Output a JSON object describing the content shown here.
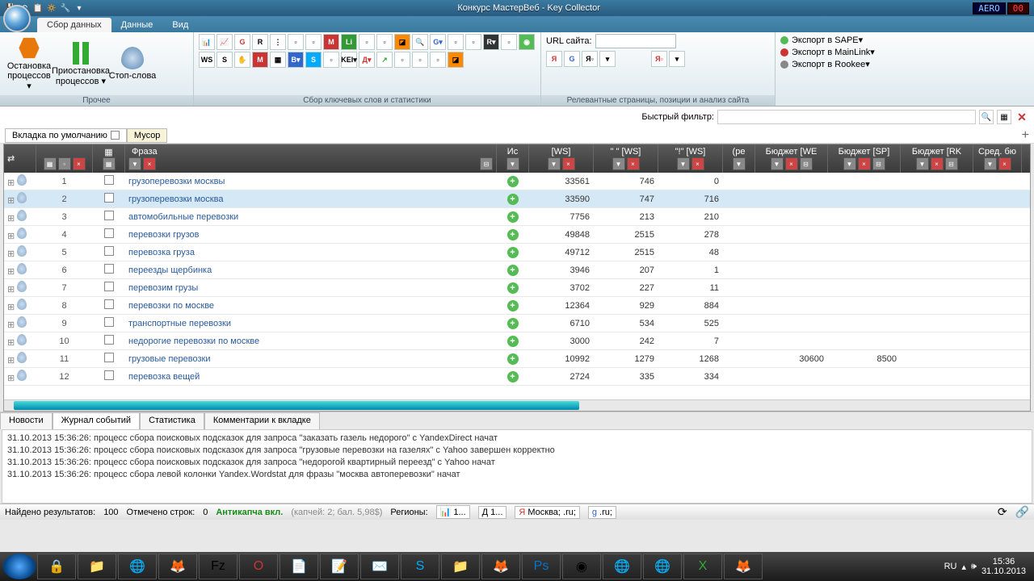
{
  "titlebar": {
    "title": "Конкурс МастерВеб - Key Collector",
    "aero_label": "AERO",
    "lcd": "00"
  },
  "tabs": {
    "t1": "Сбор данных",
    "t2": "Данные",
    "t3": "Вид"
  },
  "ribbon": {
    "stop": "Остановка процессов ▾",
    "pause": "Приостановка процессов ▾",
    "stopwords": "Стоп-слова",
    "group1": "Прочее",
    "group2": "Сбор ключевых слов и статистики",
    "url_label": "URL сайта:",
    "group3": "Релевантные страницы, позиции и анализ сайта",
    "exp_sape": "Экспорт в SAPE▾",
    "exp_main": "Экспорт в MainLink▾",
    "exp_rookee": "Экспорт в Rookee▾"
  },
  "filter": {
    "label": "Быстрый фильтр:"
  },
  "worktabs": {
    "t1": "Вкладка по умолчанию",
    "t2": "Мусор"
  },
  "cols": {
    "phrase": "Фраза",
    "src": "Ис",
    "ws": "[WS]",
    "qws": "\" \" [WS]",
    "ews": "\"!\" [WS]",
    "rel": "(ре",
    "we": "Бюджет [WE",
    "sp": "Бюджет [SP]",
    "rk": "Бюджет [RK",
    "avg": "Сред. бю"
  },
  "rows": [
    {
      "n": "1",
      "phrase": "грузоперевозки москвы",
      "ws": "33561",
      "qws": "746",
      "ews": "0"
    },
    {
      "n": "2",
      "phrase": "грузоперевозки москва",
      "ws": "33590",
      "qws": "747",
      "ews": "716",
      "sel": true
    },
    {
      "n": "3",
      "phrase": "автомобильные перевозки",
      "ws": "7756",
      "qws": "213",
      "ews": "210"
    },
    {
      "n": "4",
      "phrase": "перевозки грузов",
      "ws": "49848",
      "qws": "2515",
      "ews": "278"
    },
    {
      "n": "5",
      "phrase": "перевозка груза",
      "ws": "49712",
      "qws": "2515",
      "ews": "48"
    },
    {
      "n": "6",
      "phrase": "переезды щербинка",
      "ws": "3946",
      "qws": "207",
      "ews": "1"
    },
    {
      "n": "7",
      "phrase": "перевозим грузы",
      "ws": "3702",
      "qws": "227",
      "ews": "11"
    },
    {
      "n": "8",
      "phrase": "перевозки по москве",
      "ws": "12364",
      "qws": "929",
      "ews": "884"
    },
    {
      "n": "9",
      "phrase": "транспортные перевозки",
      "ws": "6710",
      "qws": "534",
      "ews": "525"
    },
    {
      "n": "10",
      "phrase": "недорогие перевозки по москве",
      "ws": "3000",
      "qws": "242",
      "ews": "7"
    },
    {
      "n": "11",
      "phrase": "грузовые перевозки",
      "ws": "10992",
      "qws": "1279",
      "ews": "1268",
      "we": "30600",
      "sp": "8500"
    },
    {
      "n": "12",
      "phrase": "перевозка вещей",
      "ws": "2724",
      "qws": "335",
      "ews": "334"
    }
  ],
  "btabs": {
    "t1": "Новости",
    "t2": "Журнал событий",
    "t3": "Статистика",
    "t4": "Комментарии к вкладке"
  },
  "log": {
    "l1": "31.10.2013 15:36:26: процесс сбора поисковых подсказок для запроса \"заказать газель недорого\" с YandexDirect начат",
    "l2": "31.10.2013 15:36:26: процесс сбора поисковых подсказок для запроса \"грузовые перевозки на газелях\" с Yahoo завершен корректно",
    "l3": "31.10.2013 15:36:26: процесс сбора поисковых подсказок для запроса \"недорогой квартирный переезд\" с Yahoo начат",
    "l4": "31.10.2013 15:36:26: процесс сбора левой колонки Yandex.Wordstat для фразы \"москва автоперевозки\" начат"
  },
  "status": {
    "found": "Найдено результатов:",
    "found_n": "100",
    "marked": "Отмечено строк:",
    "marked_n": "0",
    "anti": "Антикапча вкл.",
    "captcha": "(капчей: 2; бал. 5,98$)",
    "regions": "Регионы:",
    "r1": "1...",
    "r2": "1...",
    "r3": "Москва; .ru;",
    "r4": ".ru;"
  },
  "taskbar": {
    "lang": "RU",
    "time": "15:36",
    "date": "31.10.2013"
  }
}
